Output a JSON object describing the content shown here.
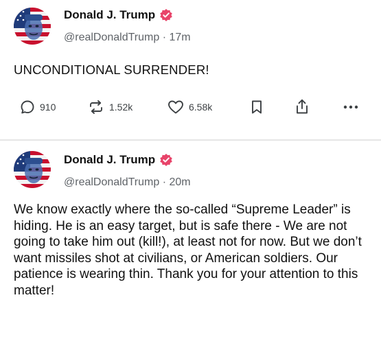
{
  "posts": [
    {
      "author_name": "Donald J. Trump",
      "handle": "@realDonaldTrump",
      "separator": "·",
      "time": "17m",
      "text": "UNCONDITIONAL SURRENDER!",
      "actions": {
        "replies": "910",
        "retruths": "1.52k",
        "likes": "6.58k"
      }
    },
    {
      "author_name": "Donald J. Trump",
      "handle": "@realDonaldTrump",
      "separator": "·",
      "time": "20m",
      "text": "We know exactly where the so-called “Supreme Leader” is hiding. He is an easy target, but is safe there - We are not going to take him out (kill!), at least not for now. But we don’t want missiles shot at civilians, or American soldiers. Our patience is wearing thin. Thank you for your attention to this matter!"
    }
  ],
  "icons": {
    "verified": "verified-badge-icon",
    "reply": "comment-icon",
    "retruth": "repost-icon",
    "like": "heart-icon",
    "bookmark": "bookmark-icon",
    "share": "share-icon",
    "more": "more-dots-icon"
  },
  "colors": {
    "verified_badge": "#e8446a",
    "text_primary": "#111111",
    "text_secondary": "#5f6368",
    "icon": "#3c4043",
    "divider": "#e6e6e6"
  }
}
